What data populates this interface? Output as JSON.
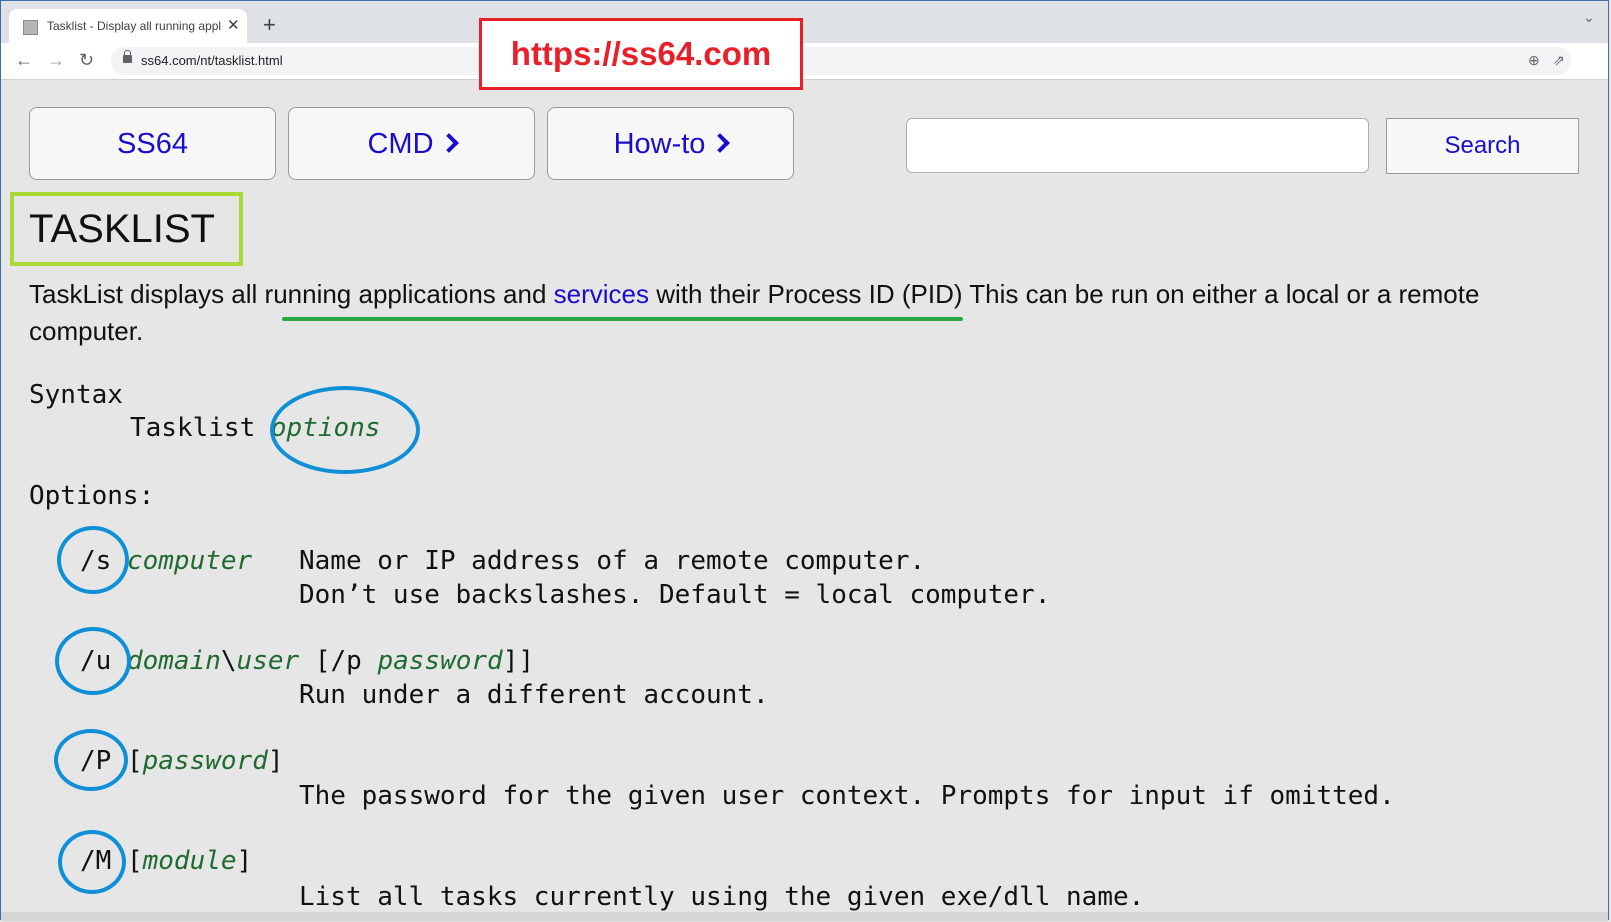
{
  "browser": {
    "tab_title": "Tasklist - Display all running appl",
    "tab_close": "✕",
    "new_tab": "+",
    "tab_menu": "⌄",
    "back": "←",
    "forward": "→",
    "reload": "↻",
    "url": "ss64.com/nt/tasklist.html",
    "zoom_icon": "⊕",
    "share_icon": "⇗"
  },
  "watermark": {
    "text": "https://ss64.com",
    "color": "#e8202a"
  },
  "nav": {
    "home_label": "SS64",
    "cmd_label": "CMD",
    "howto_label": "How-to",
    "search_placeholder": "",
    "search_button": "Search"
  },
  "page": {
    "title": "TASKLIST",
    "intro_before": "TaskList displays all running applications and ",
    "intro_link": "services",
    "intro_after": " with their Process ID (PID) This can be run on either a local or a remote computer."
  },
  "syntax": {
    "heading": "Syntax",
    "command": "Tasklist",
    "param": "options"
  },
  "options": {
    "heading": "Options:",
    "s": {
      "switch": "/s",
      "param": "computer",
      "desc1": "Name or IP address of a remote computer.",
      "desc2": "Don’t use backslashes. Default = local computer."
    },
    "u": {
      "switch": "/u",
      "param_domain": "domain",
      "sep": "\\",
      "param_user": "user",
      "open": " [/p ",
      "param_pass": "password",
      "close": "]]",
      "desc1": "Run under a different account."
    },
    "p": {
      "switch": "/P",
      "open": "[",
      "param": "password",
      "close": "]",
      "desc1": "The password for the given user context. Prompts for input if omitted."
    },
    "m": {
      "switch": "/M",
      "open": "[",
      "param": "module",
      "close": "]",
      "desc1": "List all tasks currently using the given exe/dll name."
    }
  },
  "colors": {
    "link": "#1a0dcc",
    "param": "#1f6b2f",
    "annotation_circle": "#0f8fd6",
    "title_box": "#a8d936",
    "underline": "#2aa744"
  }
}
